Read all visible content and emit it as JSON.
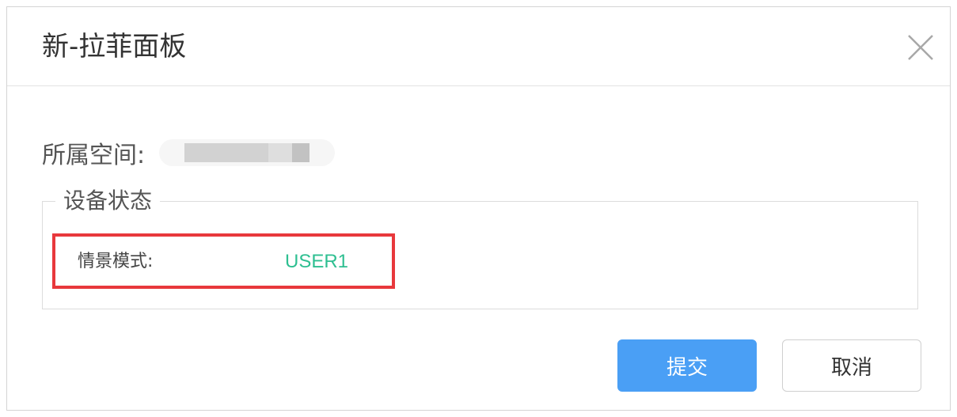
{
  "dialog": {
    "title": "新-拉菲面板",
    "close_icon": "close-icon"
  },
  "space": {
    "label": "所属空间:"
  },
  "device_status": {
    "legend": "设备状态",
    "scene_mode_label": "情景模式:",
    "scene_mode_value": "USER1",
    "value_color": "#2ebf91",
    "highlight_color": "#e8383c"
  },
  "actions": {
    "submit_label": "提交",
    "cancel_label": "取消",
    "submit_color": "#4a9ff5"
  }
}
